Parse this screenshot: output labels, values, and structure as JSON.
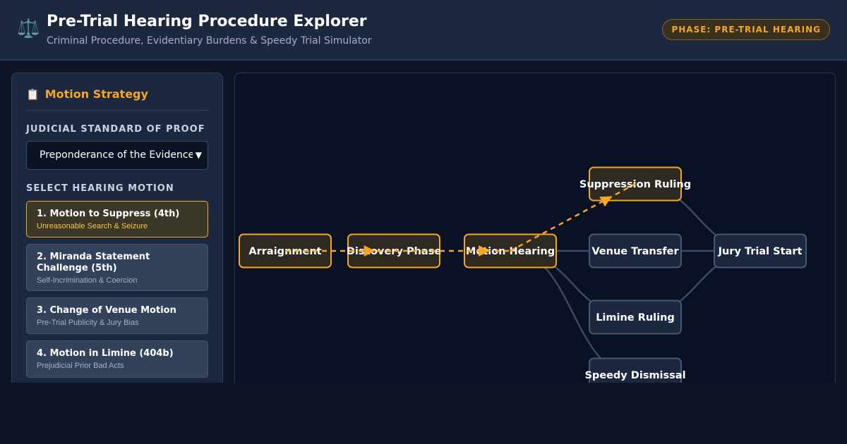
{
  "header": {
    "logo_icon": "scales-icon",
    "logo_glyph": "⚖️",
    "title": "Pre-Trial Hearing Procedure Explorer",
    "subtitle": "Criminal Procedure, Evidentiary Burdens & Speedy Trial Simulator",
    "phase_badge": "PHASE: PRE-TRIAL HEARING"
  },
  "sidebar": {
    "title_icon": "clipboard-icon",
    "title_glyph": "📋",
    "title": "Motion Strategy",
    "standard_label": "JUDICIAL STANDARD OF PROOF",
    "standard_selected": "Preponderance of the Evidence (",
    "motion_label": "SELECT HEARING MOTION",
    "motions": [
      {
        "title": "1. Motion to Suppress (4th)",
        "subtitle": "Unreasonable Search & Seizure",
        "active": true
      },
      {
        "title": "2. Miranda Statement Challenge (5th)",
        "subtitle": "Self-Incrimination & Coercion",
        "active": false
      },
      {
        "title": "3. Change of Venue Motion",
        "subtitle": "Pre-Trial Publicity & Jury Bias",
        "active": false
      },
      {
        "title": "4. Motion in Limine (404b)",
        "subtitle": "Prejudicial Prior Bad Acts",
        "active": false
      }
    ]
  },
  "flow": {
    "nodes": [
      {
        "id": "arraignment",
        "label": "Arraignment",
        "active": true
      },
      {
        "id": "discovery",
        "label": "Discovery Phase",
        "active": true
      },
      {
        "id": "motion",
        "label": "Motion Hearing",
        "active": true
      },
      {
        "id": "suppression",
        "label": "Suppression Ruling",
        "active": true
      },
      {
        "id": "venue",
        "label": "Venue Transfer",
        "active": false
      },
      {
        "id": "limine",
        "label": "Limine Ruling",
        "active": false
      },
      {
        "id": "speedy",
        "label": "Speedy Dismissal",
        "active": false
      },
      {
        "id": "jury",
        "label": "Jury Trial Start",
        "active": false
      }
    ],
    "edges": [
      {
        "from": "arraignment",
        "to": "discovery",
        "active": true
      },
      {
        "from": "discovery",
        "to": "motion",
        "active": true
      },
      {
        "from": "motion",
        "to": "suppression",
        "active": true
      },
      {
        "from": "motion",
        "to": "venue",
        "active": false
      },
      {
        "from": "motion",
        "to": "limine",
        "active": false
      },
      {
        "from": "motion",
        "to": "speedy",
        "active": false
      },
      {
        "from": "suppression",
        "to": "jury",
        "active": false
      },
      {
        "from": "venue",
        "to": "jury",
        "active": false
      },
      {
        "from": "limine",
        "to": "jury",
        "active": false
      }
    ]
  },
  "colors": {
    "accent": "#f5a623",
    "node_inactive_fill": "#1c2840",
    "node_inactive_stroke": "#4a5870",
    "node_active_fill": "#2e2a22",
    "edge_inactive": "#3a4a66"
  }
}
